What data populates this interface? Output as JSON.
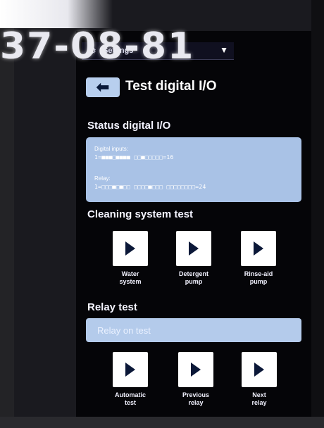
{
  "watermark": "37-08-81",
  "topbar": {
    "label": "Settings"
  },
  "header": {
    "title": "Test digital I/O"
  },
  "status": {
    "title": "Status digital I/O",
    "inputs_label": "Digital inputs:",
    "inputs_bits": "1=■■■□■■■■ □□■□□□□□=16",
    "relay_label": "Relay:",
    "relay_bits": "1=□□□■□■□□ □□□□■□□□ □□□□□□□□=24"
  },
  "cleaning": {
    "title": "Cleaning system test",
    "buttons": [
      {
        "label_line1": "Water",
        "label_line2": "system"
      },
      {
        "label_line1": "Detergent",
        "label_line2": "pump"
      },
      {
        "label_line1": "Rinse-aid",
        "label_line2": "pump"
      }
    ]
  },
  "relay": {
    "title": "Relay test",
    "field_text": "Relay on test",
    "buttons": [
      {
        "label_line1": "Automatic",
        "label_line2": "test"
      },
      {
        "label_line1": "Previous",
        "label_line2": "relay"
      },
      {
        "label_line1": "Next",
        "label_line2": "relay"
      }
    ]
  },
  "colors": {
    "panel": "#a9c2e6",
    "background": "#050508",
    "accent_dark": "#0b1838"
  }
}
